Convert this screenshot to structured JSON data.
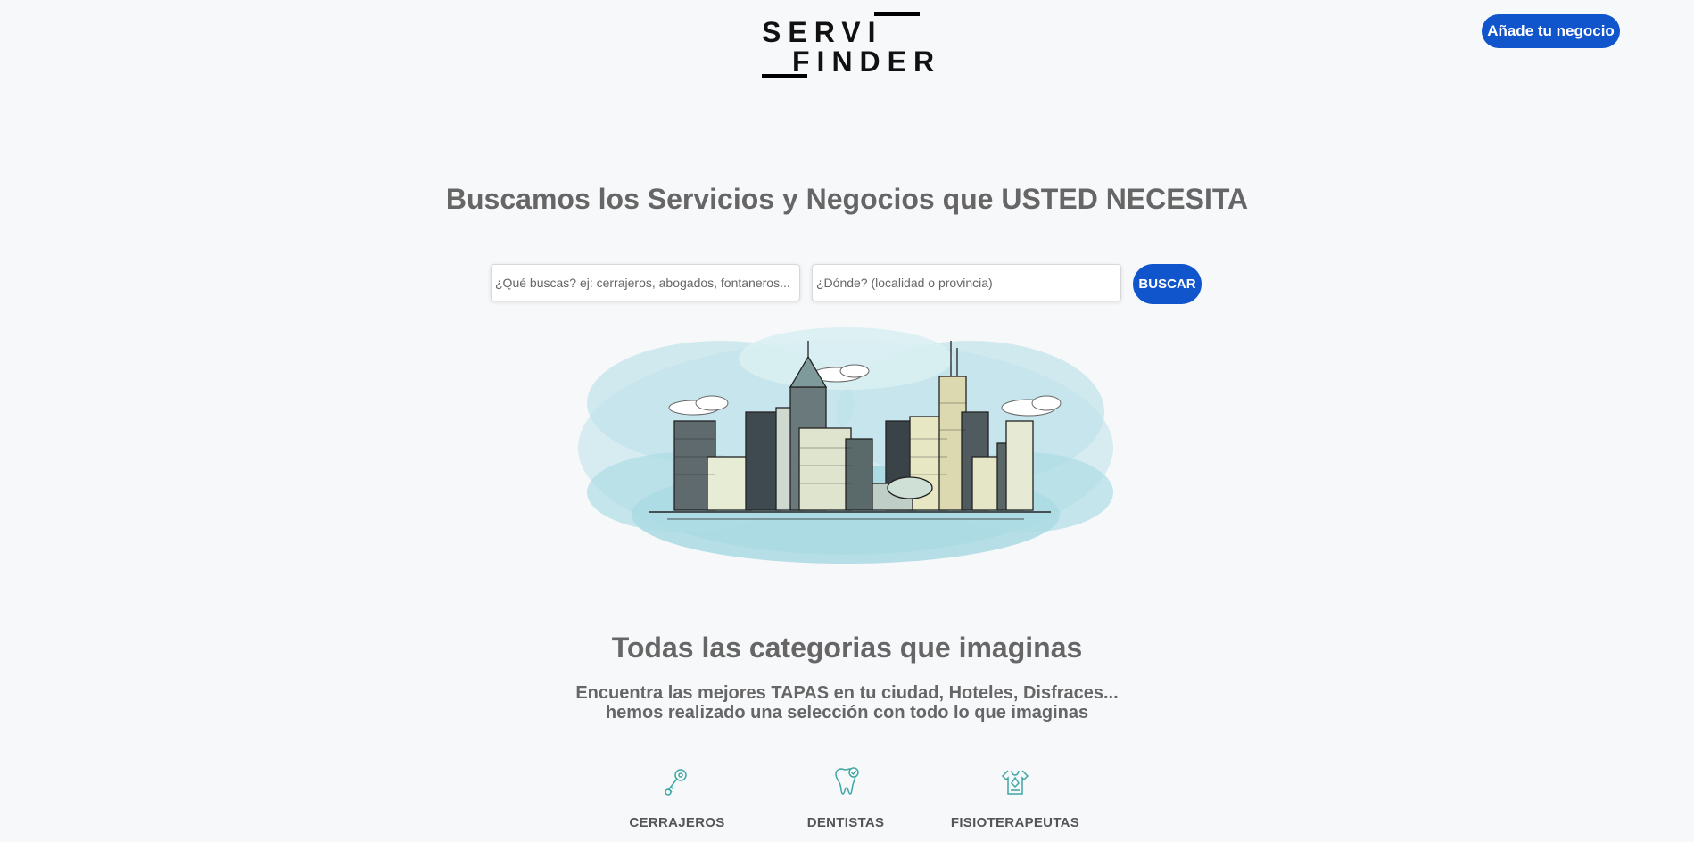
{
  "logo": {
    "line1": "SERVI",
    "line2": "FINDER"
  },
  "header": {
    "add_business_label": "Añade tu negocio"
  },
  "hero": {
    "title": "Buscamos los Servicios y Negocios que USTED NECESITA"
  },
  "search": {
    "what_placeholder": "¿Qué buscas? ej: cerrajeros, abogados, fontaneros...",
    "where_placeholder": "¿Dónde? (localidad o provincia)",
    "button_label": "BUSCAR"
  },
  "categories_section": {
    "title": "Todas las categorias que imaginas",
    "subtitle_line1": "Encuentra las mejores TAPAS en tu ciudad, Hoteles, Disfraces...",
    "subtitle_line2": "hemos realizado una selección con todo lo que imaginas",
    "items": [
      {
        "label": "CERRAJEROS",
        "icon": "key-icon"
      },
      {
        "label": "DENTISTAS",
        "icon": "tooth-icon"
      },
      {
        "label": "FISIOTERAPEUTAS",
        "icon": "physio-icon"
      }
    ]
  },
  "colors": {
    "accent": "#1155cc",
    "background": "#f7f8fa",
    "text": "#666666"
  }
}
